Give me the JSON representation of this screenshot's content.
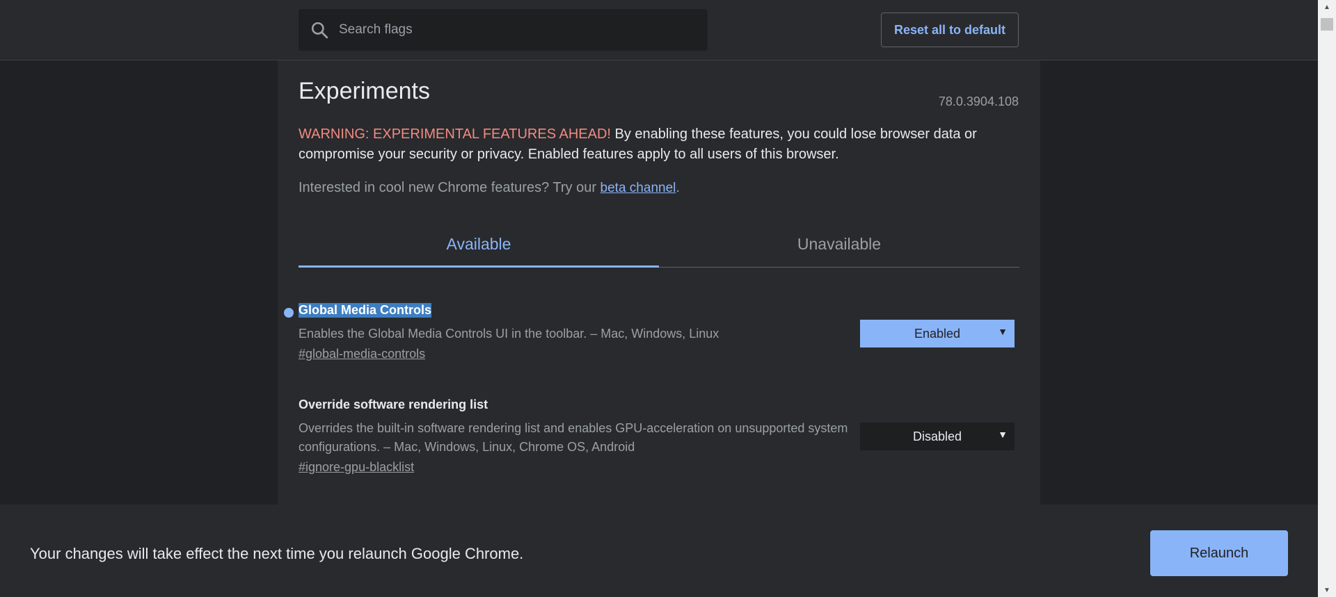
{
  "header": {
    "search_placeholder": "Search flags",
    "reset_label": "Reset all to default"
  },
  "main": {
    "title": "Experiments",
    "version": "78.0.3904.108",
    "warning_red": "WARNING: EXPERIMENTAL FEATURES AHEAD!",
    "warning_text": " By enabling these features, you could lose browser data or compromise your security or privacy. Enabled features apply to all users of this browser.",
    "interest_prefix": "Interested in cool new Chrome features? Try our ",
    "interest_link": "beta channel",
    "interest_suffix": ".",
    "tabs": [
      {
        "label": "Available"
      },
      {
        "label": "Unavailable"
      }
    ]
  },
  "flags": [
    {
      "title": "Global Media Controls",
      "description": "Enables the Global Media Controls UI in the toolbar. – Mac, Windows, Linux",
      "link": "#global-media-controls",
      "state": "Enabled"
    },
    {
      "title": "Override software rendering list",
      "description": "Overrides the built-in software rendering list and enables GPU-acceleration on unsupported system configurations. – Mac, Windows, Linux, Chrome OS, Android",
      "link": "#ignore-gpu-blacklist",
      "state": "Disabled"
    }
  ],
  "footer": {
    "message": "Your changes will take effect the next time you relaunch Google Chrome.",
    "relaunch_label": "Relaunch"
  },
  "colors": {
    "accent": "#8ab4f8",
    "warning": "#f28b82",
    "background": "#202124",
    "panel": "#292a2d"
  },
  "icons": {
    "search": "search-icon",
    "dropdown": "chevron-down-icon"
  }
}
